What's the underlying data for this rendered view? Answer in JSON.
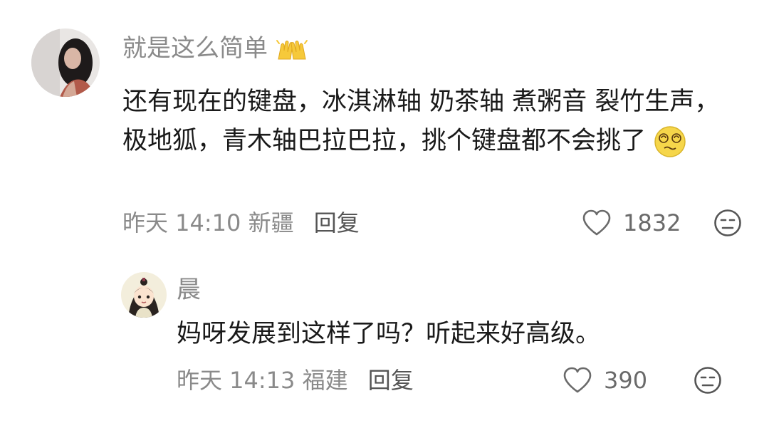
{
  "comments": [
    {
      "username": "就是这么简单",
      "username_emoji": "clapping-hands-emoji",
      "text": "还有现在的键盘，冰淇淋轴 奶茶轴 煮粥音 裂竹生声，极地狐，青木轴巴拉巴拉，挑个键盘都不会挑了",
      "text_emoji": "dizzy-face-emoji",
      "time": "昨天 14:10",
      "location": "新疆",
      "reply_label": "回复",
      "like_icon": "heart-outline-icon",
      "like_count": "1832",
      "emoji_icon": "neutral-face-icon"
    },
    {
      "username": "晨",
      "text": "妈呀发展到这样了吗？听起来好高级。",
      "time": "昨天 14:13",
      "location": "福建",
      "reply_label": "回复",
      "like_icon": "heart-outline-icon",
      "like_count": "390",
      "emoji_icon": "neutral-face-icon"
    }
  ],
  "colors": {
    "username": "#8a8a8a",
    "text": "#1a1a1a",
    "meta": "#8a8a8a",
    "emoji_yellow": "#f6d64a"
  }
}
